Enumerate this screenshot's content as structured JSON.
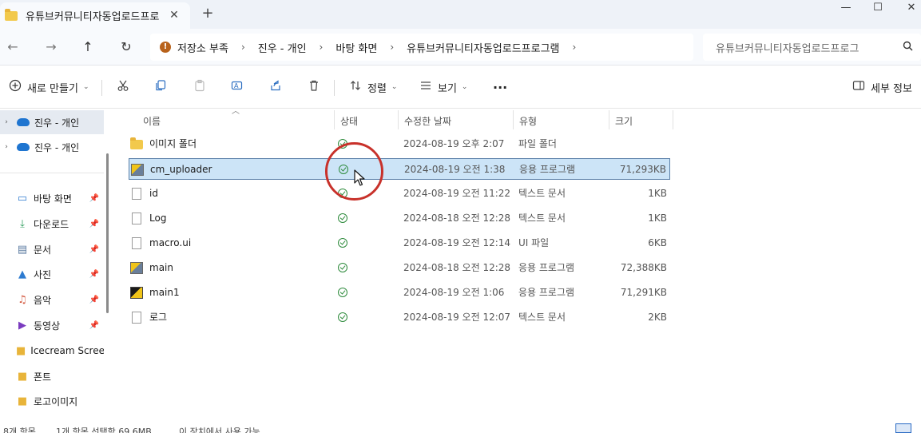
{
  "window": {
    "tab_title": "유튜브커뮤니티자동업로드프로",
    "tab_close": "✕",
    "new_tab": "+",
    "minimize": "—",
    "maximize": "☐",
    "close": "✕"
  },
  "nav": {
    "back": "←",
    "forward": "→",
    "up": "↑",
    "refresh": "↻"
  },
  "breadcrumb": {
    "warning_icon": "!",
    "items": [
      "저장소 부족",
      "진우 - 개인",
      "바탕 화면",
      "유튜브커뮤니티자동업로드프로그램"
    ],
    "separator": "›"
  },
  "search": {
    "placeholder": "유튜브커뮤니티자동업로드프로그",
    "icon": "🔍"
  },
  "toolbar": {
    "new_label": "새로 만들기",
    "sort_label": "정렬",
    "view_label": "보기",
    "more_label": "···",
    "details_label": "세부 정보",
    "caret": "⌄"
  },
  "sidebar": {
    "cloud_items": [
      "진우 - 개인",
      "진우 - 개인"
    ],
    "quick_access": [
      {
        "label": "바탕 화면",
        "icon": "desktop-icon",
        "pinned": true
      },
      {
        "label": "다운로드",
        "icon": "download-icon",
        "pinned": true
      },
      {
        "label": "문서",
        "icon": "document-icon",
        "pinned": true
      },
      {
        "label": "사진",
        "icon": "picture-icon",
        "pinned": true
      },
      {
        "label": "음악",
        "icon": "music-icon",
        "pinned": true
      },
      {
        "label": "동영상",
        "icon": "video-icon",
        "pinned": true
      },
      {
        "label": "Icecream Screen",
        "icon": "folder-icon",
        "pinned": false
      },
      {
        "label": "폰트",
        "icon": "folder-icon",
        "pinned": false
      },
      {
        "label": "로고이미지",
        "icon": "folder-icon",
        "pinned": false
      }
    ]
  },
  "columns": {
    "name": "이름",
    "status": "상태",
    "date": "수정한 날짜",
    "type": "유형",
    "size": "크기"
  },
  "files": [
    {
      "name": "이미지 폴더",
      "date": "2024-08-19 오후 2:07",
      "type": "파일 폴더",
      "size": "",
      "kind": "folder",
      "selected": false
    },
    {
      "name": "cm_uploader",
      "date": "2024-08-19 오전 1:38",
      "type": "응용 프로그램",
      "size": "71,293KB",
      "kind": "app",
      "selected": true
    },
    {
      "name": "id",
      "date": "2024-08-19 오전 11:22",
      "type": "텍스트 문서",
      "size": "1KB",
      "kind": "text",
      "selected": false
    },
    {
      "name": "Log",
      "date": "2024-08-18 오전 12:28",
      "type": "텍스트 문서",
      "size": "1KB",
      "kind": "text",
      "selected": false
    },
    {
      "name": "macro.ui",
      "date": "2024-08-19 오전 12:14",
      "type": "UI 파일",
      "size": "6KB",
      "kind": "text",
      "selected": false
    },
    {
      "name": "main",
      "date": "2024-08-18 오전 12:28",
      "type": "응용 프로그램",
      "size": "72,388KB",
      "kind": "app",
      "selected": false
    },
    {
      "name": "main1",
      "date": "2024-08-19 오전 1:06",
      "type": "응용 프로그램",
      "size": "71,291KB",
      "kind": "app2",
      "selected": false
    },
    {
      "name": "로그",
      "date": "2024-08-19 오전 12:07",
      "type": "텍스트 문서",
      "size": "2KB",
      "kind": "text",
      "selected": false
    }
  ],
  "statusbar": {
    "count": "8개 항목",
    "selection": "1개 항목 선택함 69.6MB",
    "availability": "이 장치에서 사용 가능"
  },
  "colors": {
    "selection_bg": "#cce4f7",
    "selection_border": "#5a7fa8",
    "status_green": "#2e8b3c",
    "annotation_red": "#c8312a",
    "accent_blue": "#1f75d0"
  }
}
